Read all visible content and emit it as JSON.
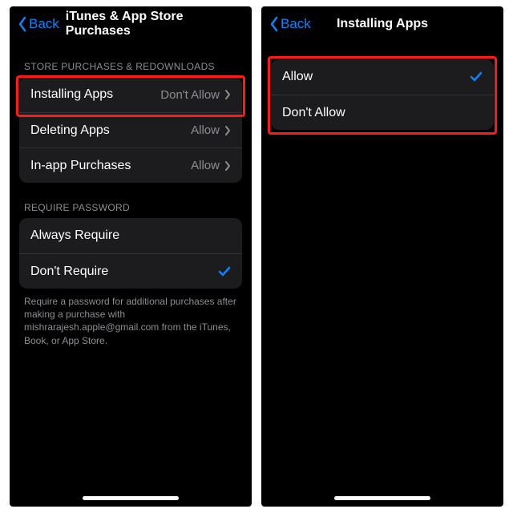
{
  "left": {
    "nav": {
      "back": "Back",
      "title": "iTunes & App Store Purchases"
    },
    "section_purchases_header": "STORE PURCHASES & REDOWNLOADS",
    "rows_purchases": [
      {
        "label": "Installing Apps",
        "value": "Don't Allow"
      },
      {
        "label": "Deleting Apps",
        "value": "Allow"
      },
      {
        "label": "In-app Purchases",
        "value": "Allow"
      }
    ],
    "section_password_header": "REQUIRE PASSWORD",
    "rows_password": [
      {
        "label": "Always Require",
        "selected": false
      },
      {
        "label": "Don't Require",
        "selected": true
      }
    ],
    "footer_note": "Require a password for additional purchases after making a purchase with mishrarajesh.apple@gmail.com from the iTunes, Book, or App Store."
  },
  "right": {
    "nav": {
      "back": "Back",
      "title": "Installing Apps"
    },
    "rows": [
      {
        "label": "Allow",
        "selected": true
      },
      {
        "label": "Don't Allow",
        "selected": false
      }
    ]
  },
  "colors": {
    "accent": "#0a84ff",
    "callout": "#ff1a1a"
  }
}
